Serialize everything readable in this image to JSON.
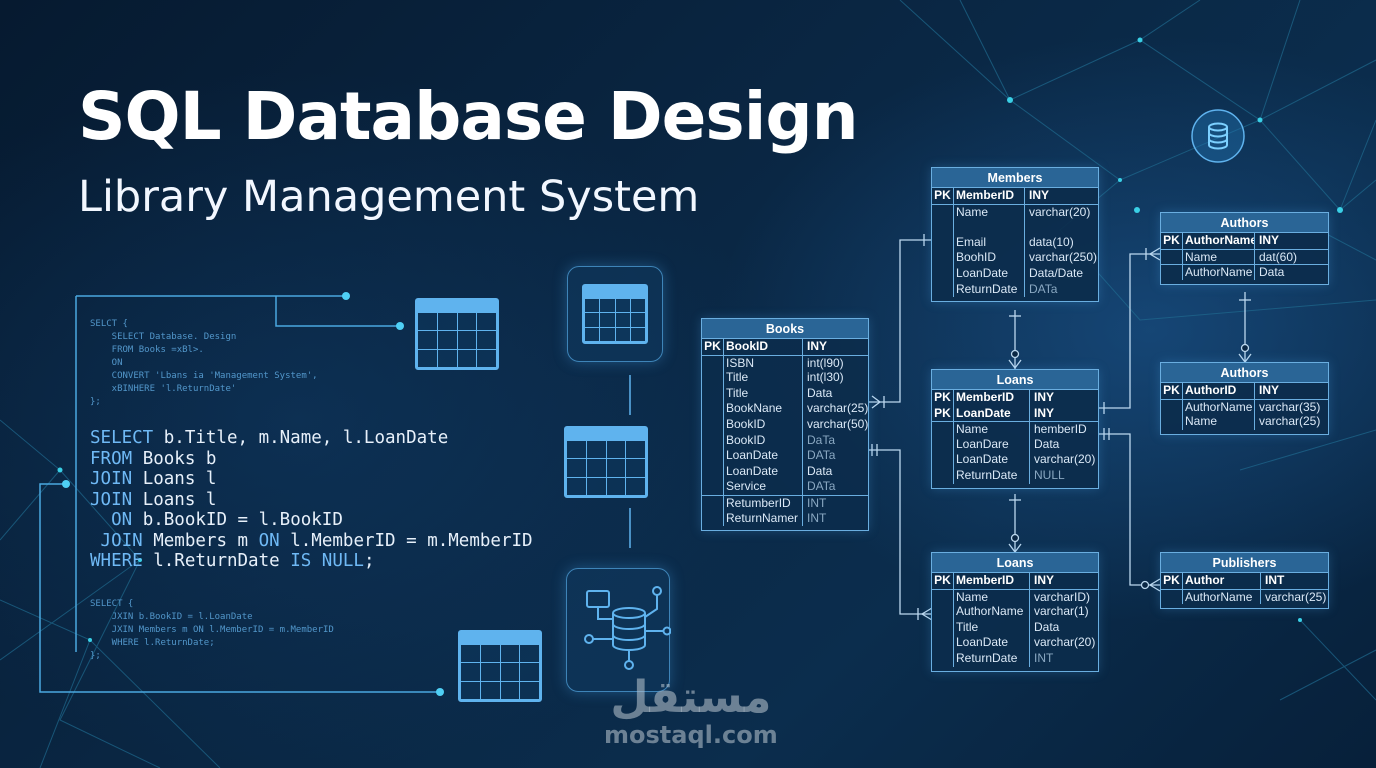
{
  "title": "SQL Database Design",
  "subtitle": "Library Management System",
  "code_small_top": [
    "SELCT {",
    "    SELECT Database. Design",
    "    FROM Books =xBl>.",
    "    ON",
    "    CONVERT 'Lbans ia 'Management System',",
    "    xBINHERE 'l.ReturnDate'",
    "};"
  ],
  "code_main": [
    {
      "kw": "SELECT",
      "rest": " b.Title, m.Name, l.LoanDate"
    },
    {
      "kw": "FROM",
      "rest": " Books b"
    },
    {
      "kw": "JOIN",
      "rest": " Loans l"
    },
    {
      "kw": "JOIN",
      "rest": " Loans l"
    },
    {
      "pre": "  ",
      "kw": "ON",
      "rest": " b.BookID = l.BookID"
    },
    {
      "pre": " ",
      "kw": "JOIN",
      "rest": " Members m ",
      "kw2": "ON",
      "rest2": " l.MemberID = m.MemberID"
    },
    {
      "kw": "WHERE",
      "rest": " l.ReturnDate ",
      "kw2": "IS NULL",
      "rest2": ";"
    }
  ],
  "code_small_bottom": [
    "SELECT {",
    "    JXIN b.BookID = l.LoanDate",
    "    JXIN Members m ON l.MemberID = m.MemberID",
    "    WHERE l.ReturnDate;",
    "};"
  ],
  "icons": {
    "table": "table-grid-icon",
    "database_network": "database-network-icon",
    "database_badge": "database-cylinder-icon"
  },
  "colors": {
    "background": "#0a2744",
    "accent": "#5fb3ee",
    "table_header": "#2a6596",
    "table_border": "#6aaee0"
  },
  "er_tables": {
    "members": {
      "name": "Members",
      "key_rows": [
        {
          "pk": "PK",
          "name": "MemberID",
          "type": "INY"
        }
      ],
      "rows": [
        {
          "name": "Name",
          "type": "varchar(20)"
        },
        {
          "name": "",
          "type": ""
        },
        {
          "name": "Email",
          "type": "data(10)"
        },
        {
          "name": "BoohID",
          "type": "varchar(250)"
        },
        {
          "name": "LoanDate",
          "type": "Data/Date"
        },
        {
          "name": "ReturnDate",
          "type": "DATa"
        }
      ]
    },
    "books": {
      "name": "Books",
      "key_rows": [
        {
          "pk": "PK",
          "name": "BookID",
          "type": "INY"
        }
      ],
      "rows": [
        {
          "name": "ISBN",
          "type": "int(l90)"
        },
        {
          "name": "Title",
          "type": "int(l30)"
        },
        {
          "name": "Title",
          "type": "Data"
        },
        {
          "name": "BookNane",
          "type": "varchar(25)"
        },
        {
          "name": "BookID",
          "type": "varchar(50)"
        },
        {
          "name": "BookID",
          "type": "DaTa"
        },
        {
          "name": "LoanDate",
          "type": "DATa"
        },
        {
          "name": "LoanDate",
          "type": "Data"
        },
        {
          "name": "Service",
          "type": "DATa"
        }
      ],
      "extra_rows": [
        {
          "name": "RetumberID",
          "type": "INT"
        },
        {
          "name": "ReturnNamer",
          "type": "INT"
        }
      ]
    },
    "loans_mid": {
      "name": "Loans",
      "key_rows": [
        {
          "pk": "PK",
          "name": "MemberID",
          "type": "INY"
        },
        {
          "pk": "PK",
          "name": "LoanDate",
          "type": "INY"
        }
      ],
      "rows": [
        {
          "name": "Name",
          "type": "hemberID"
        },
        {
          "name": "LoanDare",
          "type": "Data"
        },
        {
          "name": "LoanDate",
          "type": "varchar(20)"
        },
        {
          "name": "ReturnDate",
          "type": "NULL"
        }
      ]
    },
    "loans_bottom": {
      "name": "Loans",
      "key_rows": [
        {
          "pk": "PK",
          "name": "MemberID",
          "type": "INY"
        }
      ],
      "rows": [
        {
          "name": "Name",
          "type": "varcharID)"
        },
        {
          "name": "AuthorName",
          "type": "varchar(1)"
        },
        {
          "name": "Title",
          "type": "Data"
        },
        {
          "name": "LoanDate",
          "type": "varchar(20)"
        },
        {
          "name": "ReturnDate",
          "type": "INT"
        }
      ]
    },
    "authors_top": {
      "name": "Authors",
      "key_rows": [
        {
          "pk": "PK",
          "name": "AuthorName",
          "type": "INY"
        }
      ],
      "rows": [
        {
          "name": "Name",
          "type": "dat(60)"
        }
      ],
      "extra_rows": [
        {
          "name": "AuthorName",
          "type": "Data"
        }
      ]
    },
    "authors_mid": {
      "name": "Authors",
      "key_rows": [
        {
          "pk": "PK",
          "name": "AuthorID",
          "type": "INY"
        }
      ],
      "rows": [
        {
          "name": "AuthorName",
          "type": "varchar(35)"
        },
        {
          "name": "Name",
          "type": "varchar(25)"
        }
      ]
    },
    "publishers": {
      "name": "Publishers",
      "key_rows": [
        {
          "pk": "PK",
          "name": "Author",
          "type": "INT"
        }
      ],
      "rows": [
        {
          "name": "AuthorName",
          "type": "varchar(25)"
        }
      ]
    }
  },
  "watermark": {
    "arabic": "مستقل",
    "domain": "mostaql.com"
  }
}
